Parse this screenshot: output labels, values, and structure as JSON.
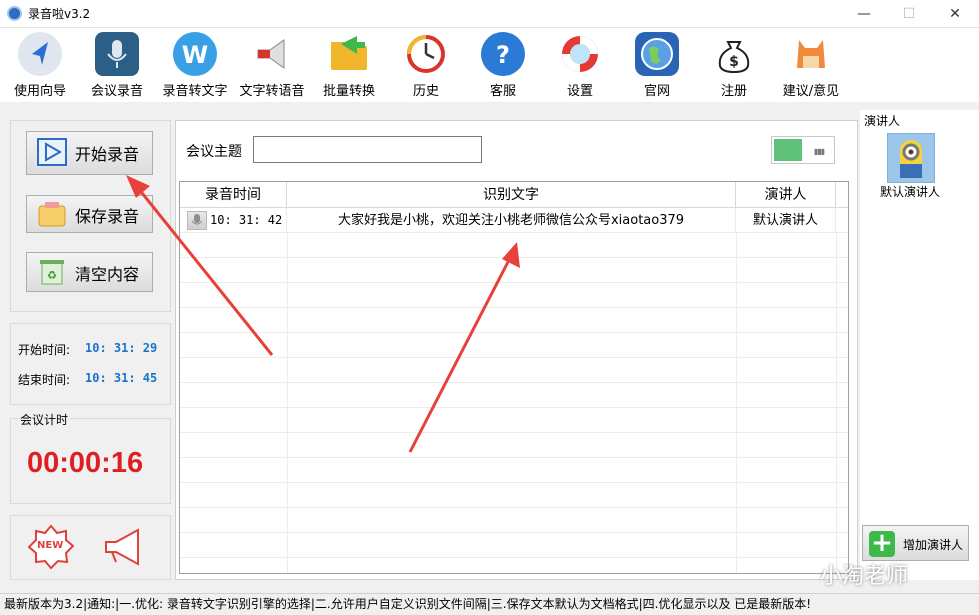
{
  "window": {
    "title": "录音啦v3.2"
  },
  "toolbar": {
    "items": [
      {
        "label": "使用向导",
        "icon": "navigation-arrow-icon"
      },
      {
        "label": "会议录音",
        "icon": "microphone-icon"
      },
      {
        "label": "录音转文字",
        "icon": "word-w-icon"
      },
      {
        "label": "文字转语音",
        "icon": "megaphone-icon"
      },
      {
        "label": "批量转换",
        "icon": "folder-arrow-icon"
      },
      {
        "label": "历史",
        "icon": "history-clock-icon"
      },
      {
        "label": "客服",
        "icon": "help-question-icon"
      },
      {
        "label": "设置",
        "icon": "lifebuoy-settings-icon"
      },
      {
        "label": "官网",
        "icon": "globe-icon"
      },
      {
        "label": "注册",
        "icon": "money-bag-icon"
      },
      {
        "label": "建议/意见",
        "icon": "cat-feedback-icon"
      }
    ]
  },
  "left": {
    "start_button": "开始录音",
    "save_button": "保存录音",
    "clear_button": "清空内容",
    "start_time_label": "开始时间:",
    "start_time_value": "10: 31: 29",
    "end_time_label": "结束时间:",
    "end_time_value": "10: 31: 45",
    "timer_label": "会议计时",
    "timer_value": "00:00:16",
    "new_badge": "NEW"
  },
  "meeting": {
    "topic_label": "会议主题",
    "topic_value": "",
    "toggle_on": true
  },
  "table": {
    "headers": [
      "录音时间",
      "识别文字",
      "演讲人"
    ],
    "rows": [
      {
        "time": "10: 31: 42",
        "text": "大家好我是小桃，欢迎关注小桃老师微信公众号xiaotao379",
        "speaker": "默认演讲人"
      }
    ]
  },
  "speakers": {
    "title": "演讲人",
    "default_name": "默认演讲人",
    "add_button": "增加演讲人"
  },
  "watermark": "小淘老师",
  "status": {
    "text": "最新版本为3.2|通知:|一.优化: 录音转文字识别引擎的选择|二.允许用户自定义识别文件间隔|三.保存文本默认为文档格式|四.优化显示以及 已是最新版本!"
  },
  "colors": {
    "accent_blue": "#1a73c9",
    "timer_red": "#e02020",
    "toggle_green": "#5fc17a",
    "arrow_red": "#e8403a"
  }
}
